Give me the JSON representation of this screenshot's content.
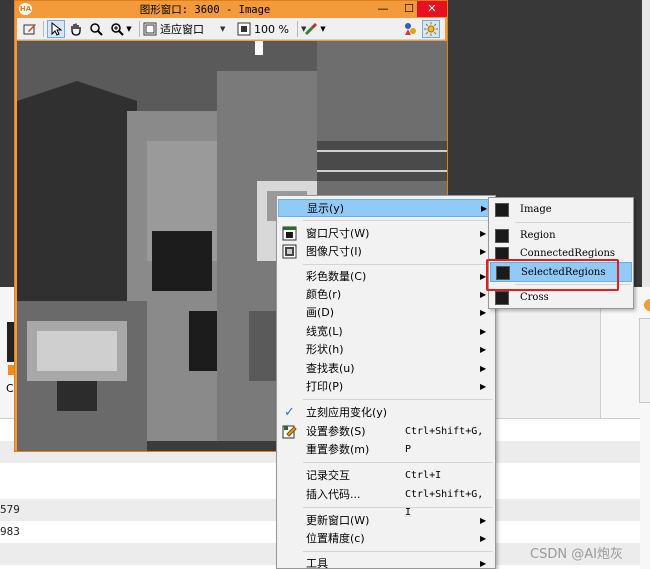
{
  "window": {
    "title": "图形窗口: 3600 - Image",
    "minimize": "—",
    "maximize": "☐",
    "close": "✕",
    "app_icon": "HA"
  },
  "toolbar": {
    "zoom_mode": "适应窗口",
    "zoom_percent": "100 %"
  },
  "context_menu": {
    "items": [
      {
        "label": "显示(y)",
        "shortcut": "",
        "submenu": true,
        "highlighted": true
      },
      {
        "label": "窗口尺寸(W)",
        "shortcut": "",
        "submenu": true
      },
      {
        "label": "图像尺寸(I)",
        "shortcut": "",
        "submenu": true
      },
      {
        "label": "彩色数量(C)",
        "shortcut": "",
        "submenu": true
      },
      {
        "label": "颜色(r)",
        "shortcut": "",
        "submenu": true
      },
      {
        "label": "画(D)",
        "shortcut": "",
        "submenu": true
      },
      {
        "label": "线宽(L)",
        "shortcut": "",
        "submenu": true
      },
      {
        "label": "形状(h)",
        "shortcut": "",
        "submenu": true
      },
      {
        "label": "查找表(u)",
        "shortcut": "",
        "submenu": true
      },
      {
        "label": "打印(P)",
        "shortcut": "",
        "submenu": true
      },
      {
        "label": "立刻应用变化(y)",
        "shortcut": "",
        "checked": true
      },
      {
        "label": "设置参数(S)",
        "shortcut": "Ctrl+Shift+G, P"
      },
      {
        "label": "重置参数(m)",
        "shortcut": ""
      },
      {
        "label": "记录交互",
        "shortcut": "Ctrl+I"
      },
      {
        "label": "插入代码...",
        "shortcut": "Ctrl+Shift+G, I"
      },
      {
        "label": "更新窗口(W)",
        "shortcut": "",
        "submenu": true
      },
      {
        "label": "位置精度(c)",
        "shortcut": "",
        "submenu": true
      },
      {
        "label": "工具",
        "shortcut": "",
        "submenu": true
      }
    ],
    "submenu_arrow": "▶",
    "check_mark": "✓"
  },
  "display_submenu": {
    "items": [
      "Image",
      "Region",
      "ConnectedRegions",
      "SelectedRegions",
      "Cross"
    ],
    "selected": "SelectedRegions"
  },
  "background": {
    "rows": [
      "",
      "",
      "",
      "579",
      "983",
      ""
    ],
    "left_letter": "C"
  },
  "watermark": "CSDN @AI炮灰",
  "colors": {
    "window_frame": "#f29a3c",
    "highlight": "#91c9f7",
    "annotation_red": "#e02020"
  }
}
